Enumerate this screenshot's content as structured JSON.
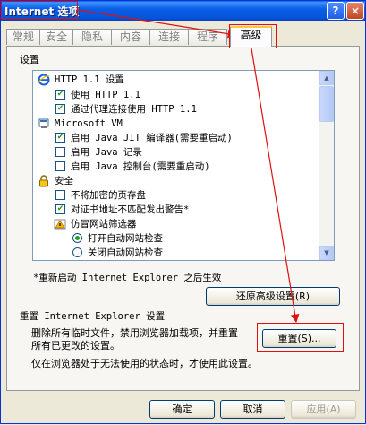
{
  "window": {
    "title": "Internet 选项",
    "help_label": "?",
    "close_label": "×"
  },
  "tabs": [
    "常规",
    "安全",
    "隐私",
    "内容",
    "连接",
    "程序",
    "高级"
  ],
  "settings_label": "设置",
  "tree": [
    {
      "kind": "group",
      "label": "HTTP 1.1 设置",
      "icon": "ie-icon"
    },
    {
      "kind": "checkbox",
      "label": "使用 HTTP 1.1",
      "checked": true
    },
    {
      "kind": "checkbox",
      "label": "通过代理连接使用 HTTP 1.1",
      "checked": true
    },
    {
      "kind": "group",
      "label": "Microsoft VM",
      "icon": "java-icon"
    },
    {
      "kind": "checkbox",
      "label": "启用 Java JIT 编译器(需要重启动)",
      "checked": true
    },
    {
      "kind": "checkbox",
      "label": "启用 Java 记录",
      "checked": false
    },
    {
      "kind": "checkbox",
      "label": "启用 Java 控制台(需要重启动)",
      "checked": false
    },
    {
      "kind": "group",
      "label": "安全",
      "icon": "lock-icon"
    },
    {
      "kind": "checkbox",
      "label": "不将加密的页存盘",
      "checked": false
    },
    {
      "kind": "checkbox",
      "label": "对证书地址不匹配发出警告*",
      "checked": true
    },
    {
      "kind": "subgroup",
      "label": "仿冒网站筛选器",
      "icon": "phishing-filter-icon"
    },
    {
      "kind": "radio",
      "label": "打开自动网站检查",
      "checked": true
    },
    {
      "kind": "radio",
      "label": "关闭自动网站检查",
      "checked": false
    }
  ],
  "restart_note": "*重新启动 Internet Explorer 之后生效",
  "restore_button": "还原高级设置(R)",
  "reset_section": {
    "title": "重置 Internet Explorer 设置",
    "description_line1": "删除所有临时文件，禁用浏览器加载项，并重置",
    "description_line2": "所有已更改的设置。",
    "reset_button": "重置(S)...",
    "note": "仅在浏览器处于无法使用的状态时，才使用此设置。"
  },
  "footer": {
    "ok": "确定",
    "cancel": "取消",
    "apply": "应用(A)"
  },
  "colors": {
    "title_bar": "#0553db",
    "annotation_red": "#e01010",
    "check_green": "#21a121"
  }
}
